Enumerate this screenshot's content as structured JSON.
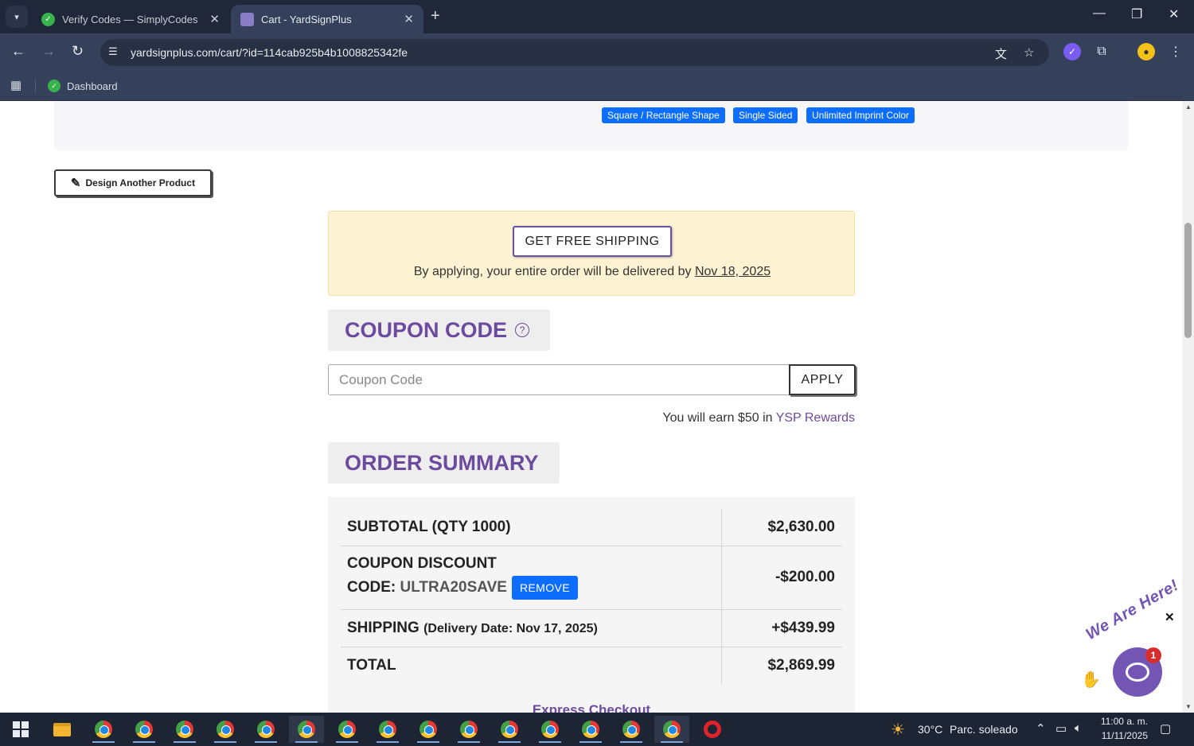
{
  "browser": {
    "tabs": [
      {
        "title": "Verify Codes — SimplyCodes",
        "favicon": "simplycodes-icon"
      },
      {
        "title": "Cart - YardSignPlus",
        "favicon": "yardsignplus-icon"
      }
    ],
    "url": "yardsignplus.com/cart/?id=114cab925b4b1008825342fe",
    "bookmarks": [
      {
        "label": "Dashboard"
      }
    ]
  },
  "product": {
    "tags": [
      "Square / Rectangle Shape",
      "Single Sided",
      "Unlimited Imprint Color"
    ]
  },
  "design_button": "Design Another Product",
  "shipping_offer": {
    "button": "GET FREE SHIPPING",
    "text_prefix": "By applying, your entire order will be delivered by ",
    "date": "Nov 18, 2025"
  },
  "coupon": {
    "title": "COUPON CODE",
    "help_icon": "?",
    "placeholder": "Coupon Code",
    "apply": "APPLY"
  },
  "rewards": {
    "prefix": "You will earn $50 in ",
    "link": "YSP Rewards"
  },
  "order_summary": {
    "title": "ORDER SUMMARY",
    "subtotal_label": "SUBTOTAL (QTY 1000)",
    "subtotal_value": "$2,630.00",
    "discount_label": "COUPON DISCOUNT",
    "discount_code_label": "CODE: ",
    "discount_code": "ULTRA20SAVE",
    "remove": "REMOVE",
    "discount_value": "-$200.00",
    "shipping_label": "SHIPPING",
    "shipping_note": "(Delivery Date: Nov 17, 2025)",
    "shipping_value": "+$439.99",
    "total_label": "TOTAL",
    "total_value": "$2,869.99",
    "express_checkout": "Express Checkout"
  },
  "chat_widget": {
    "text": "We Are Here!",
    "badge": "1"
  },
  "taskbar": {
    "weather_temp": "30°C",
    "weather_desc": "Parc. soleado",
    "time": "11:00 a. m.",
    "date": "11/11/2025"
  },
  "colors": {
    "brand_purple": "#6c4a9e",
    "tag_blue": "#0d6efd",
    "shipping_bg": "#fdf3d2"
  }
}
